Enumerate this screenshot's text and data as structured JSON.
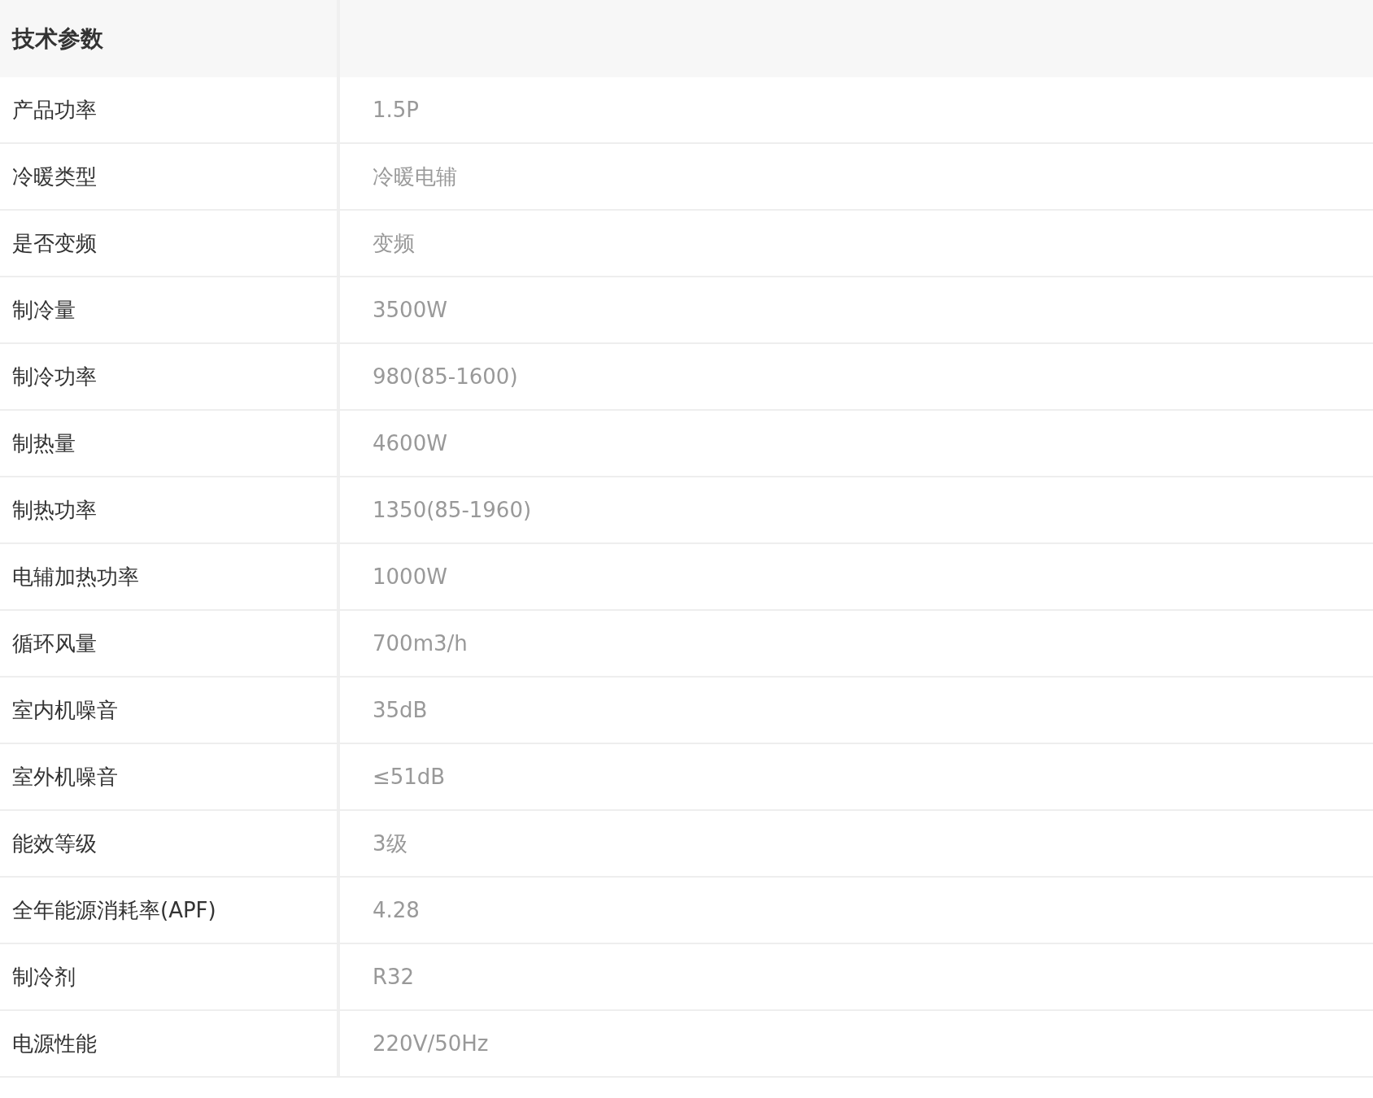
{
  "table": {
    "title": "技术参数",
    "rows": [
      {
        "label": "产品功率",
        "value": "1.5P"
      },
      {
        "label": "冷暖类型",
        "value": "冷暖电辅"
      },
      {
        "label": "是否变频",
        "value": "变频"
      },
      {
        "label": "制冷量",
        "value": "3500W"
      },
      {
        "label": "制冷功率",
        "value": "980(85-1600)"
      },
      {
        "label": "制热量",
        "value": "4600W"
      },
      {
        "label": "制热功率",
        "value": "1350(85-1960)"
      },
      {
        "label": "电辅加热功率",
        "value": "1000W"
      },
      {
        "label": "循环风量",
        "value": "700m3/h"
      },
      {
        "label": "室内机噪音",
        "value": "35dB"
      },
      {
        "label": "室外机噪音",
        "value": "≤51dB"
      },
      {
        "label": "能效等级",
        "value": "3级"
      },
      {
        "label": "全年能源消耗率(APF)",
        "value": "4.28"
      },
      {
        "label": "制冷剂",
        "value": "R32"
      },
      {
        "label": "电源性能",
        "value": "220V/50Hz"
      }
    ]
  }
}
